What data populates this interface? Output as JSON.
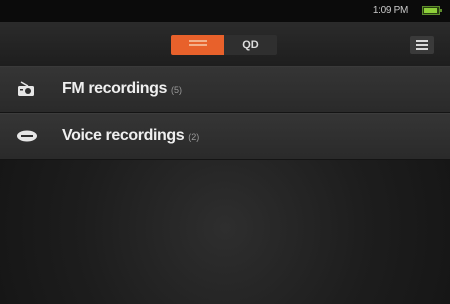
{
  "status": {
    "time": "1:09 PM",
    "battery_level": 0.8,
    "battery_color": "#8fd13a"
  },
  "toolbar": {
    "toggle": [
      {
        "label": "",
        "active": true,
        "icon": "list-icon"
      },
      {
        "label": "QD",
        "active": false,
        "icon": "folder-icon"
      }
    ],
    "menu_icon": "menu-icon",
    "accent": "#e8612b"
  },
  "recordings": [
    {
      "label": "FM recordings",
      "count": "(5)",
      "icon": "radio-icon"
    },
    {
      "label": "Voice recordings",
      "count": "(2)",
      "icon": "voice-icon"
    }
  ]
}
